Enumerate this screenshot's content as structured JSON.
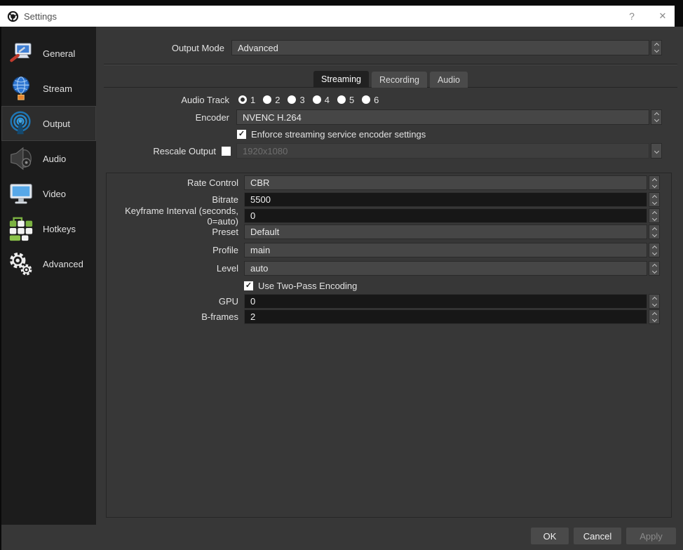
{
  "window": {
    "title": "Settings",
    "help_label": "?",
    "close_label": "✕"
  },
  "glyphs": {
    "check": "✓"
  },
  "colors": {
    "titlebar_bg": "#ffffff",
    "window_bg": "#373737",
    "sidebar_bg": "#1c1c1c",
    "sidebar_selected_bg": "#2d2d2d",
    "combo_bg": "#464646",
    "spinbox_bg": "#171717",
    "selected_tab_bg": "#212121",
    "disabled_text": "#6e6e6e",
    "output_icon_accent": "#2586c9"
  },
  "sidebar": {
    "items": [
      {
        "label": "General",
        "icon": "general-icon",
        "selected": false
      },
      {
        "label": "Stream",
        "icon": "stream-icon",
        "selected": false
      },
      {
        "label": "Output",
        "icon": "output-icon",
        "selected": true
      },
      {
        "label": "Audio",
        "icon": "audio-icon",
        "selected": false
      },
      {
        "label": "Video",
        "icon": "video-icon",
        "selected": false
      },
      {
        "label": "Hotkeys",
        "icon": "hotkeys-icon",
        "selected": false
      },
      {
        "label": "Advanced",
        "icon": "advanced-icon",
        "selected": false
      }
    ]
  },
  "output_mode": {
    "label": "Output Mode",
    "value": "Advanced"
  },
  "tabs": [
    {
      "label": "Streaming",
      "selected": true
    },
    {
      "label": "Recording",
      "selected": false
    },
    {
      "label": "Audio",
      "selected": false
    }
  ],
  "streaming": {
    "audio_track": {
      "label": "Audio Track",
      "options": [
        "1",
        "2",
        "3",
        "4",
        "5",
        "6"
      ],
      "selected": "1"
    },
    "encoder": {
      "label": "Encoder",
      "value": "NVENC H.264"
    },
    "enforce": {
      "label": "Enforce streaming service encoder settings",
      "checked": true
    },
    "rescale": {
      "label": "Rescale Output",
      "checked": false,
      "value": "1920x1080",
      "disabled": true
    },
    "encoder_settings": [
      {
        "label": "Rate Control",
        "type": "combo",
        "value": "CBR"
      },
      {
        "label": "Bitrate",
        "type": "spin",
        "value": "5500"
      },
      {
        "label": "Keyframe Interval (seconds, 0=auto)",
        "type": "spin",
        "value": "0"
      },
      {
        "label": "Preset",
        "type": "combo",
        "value": "Default"
      },
      {
        "label": "Profile",
        "type": "combo",
        "value": "main"
      },
      {
        "label": "Level",
        "type": "combo",
        "value": "auto"
      },
      {
        "label": "Use Two-Pass Encoding",
        "type": "check",
        "checked": true
      },
      {
        "label": "GPU",
        "type": "spin",
        "value": "0"
      },
      {
        "label": "B-frames",
        "type": "spin",
        "value": "2"
      }
    ]
  },
  "footer": {
    "buttons": [
      {
        "label": "OK",
        "enabled": true
      },
      {
        "label": "Cancel",
        "enabled": true
      },
      {
        "label": "Apply",
        "enabled": false
      }
    ]
  }
}
